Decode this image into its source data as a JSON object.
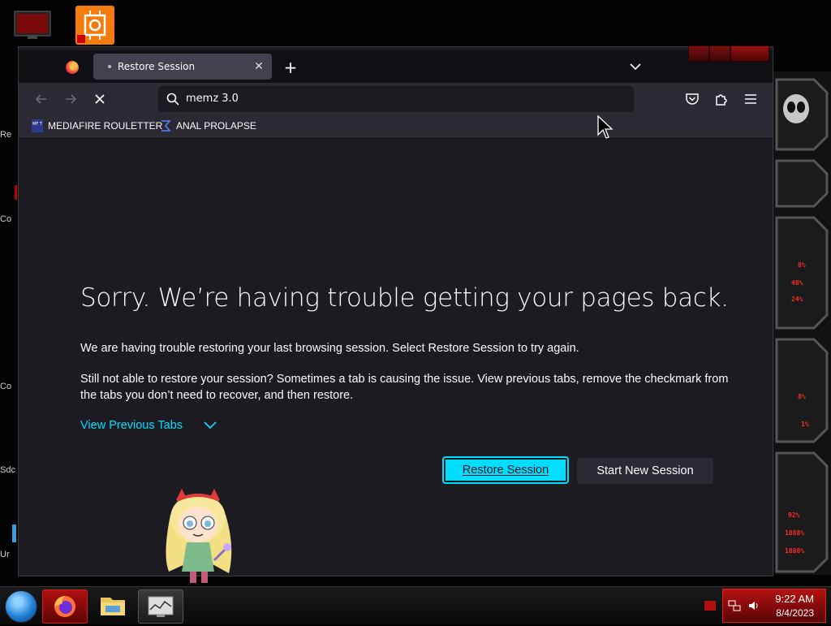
{
  "desktop": {
    "edge_labels": [
      "Re",
      "Co",
      "Co",
      "Sdc",
      "Ur"
    ],
    "hud_values": [
      "8%",
      "48%",
      "24%",
      "8%",
      "1%",
      "92%",
      "1888%",
      "1888%"
    ]
  },
  "browser": {
    "tab": {
      "title": "Restore Session"
    },
    "url": "memz 3.0",
    "bookmarks": [
      {
        "label": "MEDIAFIRE ROULETTER",
        "icon_text": "MF T"
      },
      {
        "label": "ANAL PROLAPSE"
      }
    ]
  },
  "page": {
    "title": "Sorry. We’re having trouble getting your pages back.",
    "p1": "We are having trouble restoring your last browsing session. Select Restore Session to try again.",
    "p2": "Still not able to restore your session? Sometimes a tab is causing the issue. View previous tabs, remove the checkmark from the tabs you don’t need to recover, and then restore.",
    "view_previous": "View Previous Tabs",
    "restore_label": "Restore Session",
    "new_session_label": "Start New Session"
  },
  "taskbar": {
    "time": "9:22 AM",
    "date": "8/4/2023"
  },
  "colors": {
    "accent": "#00ddff",
    "window_bg": "#1c1b22",
    "toolbar_bg": "#2b2a33",
    "tray_red": "#b41212"
  },
  "icons": [
    "firefox-icon",
    "search-icon",
    "back-icon",
    "forward-icon",
    "stop-icon",
    "pocket-icon",
    "extensions-icon",
    "menu-icon",
    "chevron-down-icon",
    "network-icon",
    "volume-icon"
  ]
}
